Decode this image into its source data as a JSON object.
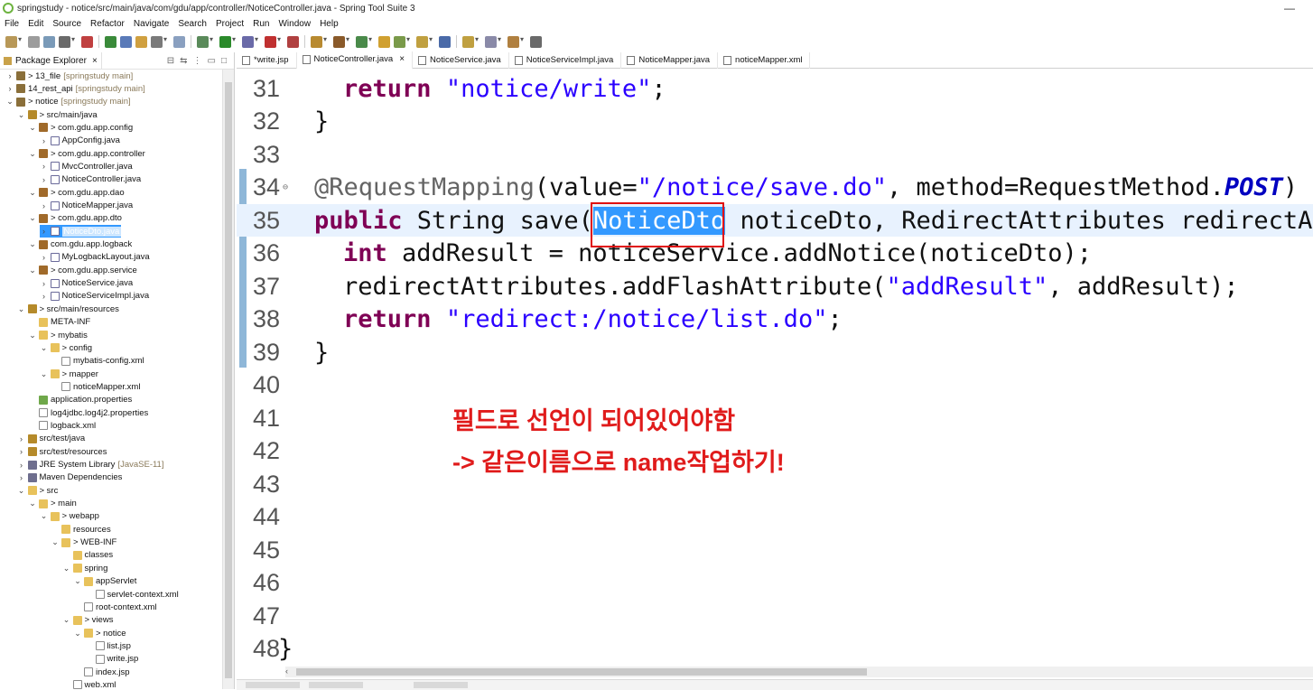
{
  "window": {
    "title": "springstudy - notice/src/main/java/com/gdu/app/controller/NoticeController.java - Spring Tool Suite 3",
    "minimize": "—"
  },
  "menu": [
    "File",
    "Edit",
    "Source",
    "Refactor",
    "Navigate",
    "Search",
    "Project",
    "Run",
    "Window",
    "Help"
  ],
  "explorer": {
    "tab_label": "Package Explorer",
    "close": "×",
    "tree": [
      {
        "label": "> 13_file",
        "suffix": "[springstudy main]",
        "depth": 0,
        "tw": "›",
        "icon": "proj"
      },
      {
        "label": "14_rest_api",
        "suffix": "[springstudy main]",
        "depth": 0,
        "tw": "›",
        "icon": "proj"
      },
      {
        "label": "> notice",
        "suffix": "[springstudy main]",
        "depth": 0,
        "tw": "⌄",
        "icon": "proj"
      },
      {
        "label": "> src/main/java",
        "suffix": "",
        "depth": 1,
        "tw": "⌄",
        "icon": "src"
      },
      {
        "label": "> com.gdu.app.config",
        "suffix": "",
        "depth": 2,
        "tw": "⌄",
        "icon": "pkg"
      },
      {
        "label": "AppConfig.java",
        "suffix": "",
        "depth": 3,
        "tw": "›",
        "icon": "java"
      },
      {
        "label": "> com.gdu.app.controller",
        "suffix": "",
        "depth": 2,
        "tw": "⌄",
        "icon": "pkg"
      },
      {
        "label": "MvcController.java",
        "suffix": "",
        "depth": 3,
        "tw": "›",
        "icon": "java"
      },
      {
        "label": "NoticeController.java",
        "suffix": "",
        "depth": 3,
        "tw": "›",
        "icon": "java"
      },
      {
        "label": "> com.gdu.app.dao",
        "suffix": "",
        "depth": 2,
        "tw": "⌄",
        "icon": "pkg"
      },
      {
        "label": "NoticeMapper.java",
        "suffix": "",
        "depth": 3,
        "tw": "›",
        "icon": "java"
      },
      {
        "label": "> com.gdu.app.dto",
        "suffix": "",
        "depth": 2,
        "tw": "⌄",
        "icon": "pkg"
      },
      {
        "label": "NoticeDto.java",
        "suffix": "",
        "depth": 3,
        "tw": "›",
        "icon": "java",
        "selected": true
      },
      {
        "label": "com.gdu.app.logback",
        "suffix": "",
        "depth": 2,
        "tw": "⌄",
        "icon": "pkg"
      },
      {
        "label": "MyLogbackLayout.java",
        "suffix": "",
        "depth": 3,
        "tw": "›",
        "icon": "java"
      },
      {
        "label": "> com.gdu.app.service",
        "suffix": "",
        "depth": 2,
        "tw": "⌄",
        "icon": "pkg"
      },
      {
        "label": "NoticeService.java",
        "suffix": "",
        "depth": 3,
        "tw": "›",
        "icon": "java"
      },
      {
        "label": "NoticeServiceImpl.java",
        "suffix": "",
        "depth": 3,
        "tw": "›",
        "icon": "java"
      },
      {
        "label": "> src/main/resources",
        "suffix": "",
        "depth": 1,
        "tw": "⌄",
        "icon": "src"
      },
      {
        "label": "META-INF",
        "suffix": "",
        "depth": 2,
        "tw": "",
        "icon": "fold"
      },
      {
        "label": "> mybatis",
        "suffix": "",
        "depth": 2,
        "tw": "⌄",
        "icon": "fold"
      },
      {
        "label": "> config",
        "suffix": "",
        "depth": 3,
        "tw": "⌄",
        "icon": "fold"
      },
      {
        "label": "mybatis-config.xml",
        "suffix": "",
        "depth": 4,
        "tw": "",
        "icon": "xml"
      },
      {
        "label": "> mapper",
        "suffix": "",
        "depth": 3,
        "tw": "⌄",
        "icon": "fold"
      },
      {
        "label": "noticeMapper.xml",
        "suffix": "",
        "depth": 4,
        "tw": "",
        "icon": "xml"
      },
      {
        "label": "application.properties",
        "suffix": "",
        "depth": 2,
        "tw": "",
        "icon": "prop"
      },
      {
        "label": "log4jdbc.log4j2.properties",
        "suffix": "",
        "depth": 2,
        "tw": "",
        "icon": "xml"
      },
      {
        "label": "logback.xml",
        "suffix": "",
        "depth": 2,
        "tw": "",
        "icon": "xml"
      },
      {
        "label": "src/test/java",
        "suffix": "",
        "depth": 1,
        "tw": "›",
        "icon": "src"
      },
      {
        "label": "src/test/resources",
        "suffix": "",
        "depth": 1,
        "tw": "›",
        "icon": "src"
      },
      {
        "label": "JRE System Library",
        "suffix": "[JavaSE-11]",
        "depth": 1,
        "tw": "›",
        "icon": "lib"
      },
      {
        "label": "Maven Dependencies",
        "suffix": "",
        "depth": 1,
        "tw": "›",
        "icon": "lib"
      },
      {
        "label": "> src",
        "suffix": "",
        "depth": 1,
        "tw": "⌄",
        "icon": "fold"
      },
      {
        "label": "> main",
        "suffix": "",
        "depth": 2,
        "tw": "⌄",
        "icon": "fold"
      },
      {
        "label": "> webapp",
        "suffix": "",
        "depth": 3,
        "tw": "⌄",
        "icon": "fold"
      },
      {
        "label": "resources",
        "suffix": "",
        "depth": 4,
        "tw": "",
        "icon": "fold"
      },
      {
        "label": "> WEB-INF",
        "suffix": "",
        "depth": 4,
        "tw": "⌄",
        "icon": "fold"
      },
      {
        "label": "classes",
        "suffix": "",
        "depth": 5,
        "tw": "",
        "icon": "fold"
      },
      {
        "label": "spring",
        "suffix": "",
        "depth": 5,
        "tw": "⌄",
        "icon": "fold"
      },
      {
        "label": "appServlet",
        "suffix": "",
        "depth": 6,
        "tw": "⌄",
        "icon": "fold"
      },
      {
        "label": "servlet-context.xml",
        "suffix": "",
        "depth": 7,
        "tw": "",
        "icon": "xml"
      },
      {
        "label": "root-context.xml",
        "suffix": "",
        "depth": 6,
        "tw": "",
        "icon": "xml"
      },
      {
        "label": "> views",
        "suffix": "",
        "depth": 5,
        "tw": "⌄",
        "icon": "fold"
      },
      {
        "label": "> notice",
        "suffix": "",
        "depth": 6,
        "tw": "⌄",
        "icon": "fold"
      },
      {
        "label": "list.jsp",
        "suffix": "",
        "depth": 7,
        "tw": "",
        "icon": "xml"
      },
      {
        "label": "write.jsp",
        "suffix": "",
        "depth": 7,
        "tw": "",
        "icon": "xml"
      },
      {
        "label": "index.jsp",
        "suffix": "",
        "depth": 6,
        "tw": "",
        "icon": "xml"
      },
      {
        "label": "web.xml",
        "suffix": "",
        "depth": 5,
        "tw": "",
        "icon": "xml"
      }
    ]
  },
  "tabs": [
    {
      "label": "*write.jsp",
      "active": false,
      "close": ""
    },
    {
      "label": "NoticeController.java",
      "active": true,
      "close": "×"
    },
    {
      "label": "NoticeService.java",
      "active": false,
      "close": ""
    },
    {
      "label": "NoticeServiceImpl.java",
      "active": false,
      "close": ""
    },
    {
      "label": "NoticeMapper.java",
      "active": false,
      "close": ""
    },
    {
      "label": "noticeMapper.xml",
      "active": false,
      "close": ""
    }
  ],
  "code": [
    {
      "n": "31",
      "indent": 1,
      "parts": [
        {
          "t": "return",
          "c": "kw"
        },
        {
          "t": " ",
          "c": ""
        },
        {
          "t": "\"notice/write\"",
          "c": "str"
        },
        {
          "t": ";",
          "c": ""
        }
      ]
    },
    {
      "n": "32",
      "indent": 0,
      "parts": [
        {
          "t": "}",
          "c": ""
        }
      ]
    },
    {
      "n": "33",
      "indent": 0,
      "parts": []
    },
    {
      "n": "34",
      "indent": 0,
      "fold": "⊖",
      "parts": [
        {
          "t": "@RequestMapping",
          "c": "ann"
        },
        {
          "t": "(value=",
          "c": ""
        },
        {
          "t": "\"/notice/save.do\"",
          "c": "str"
        },
        {
          "t": ", method=RequestMethod.",
          "c": ""
        },
        {
          "t": "POST",
          "c": "ital"
        },
        {
          "t": ")",
          "c": ""
        }
      ]
    },
    {
      "n": "35",
      "indent": 0,
      "cur": true,
      "parts": [
        {
          "t": "public",
          "c": "kw"
        },
        {
          "t": " String save(",
          "c": ""
        },
        {
          "t": "NoticeDto",
          "c": "sel"
        },
        {
          "t": " noticeDto, RedirectAttributes redirectAtt",
          "c": ""
        }
      ]
    },
    {
      "n": "36",
      "indent": 1,
      "parts": [
        {
          "t": "int",
          "c": "kw"
        },
        {
          "t": " addResult = noticeService.addNotice(noticeDto);",
          "c": ""
        }
      ]
    },
    {
      "n": "37",
      "indent": 1,
      "parts": [
        {
          "t": "redirectAttributes.addFlashAttribute(",
          "c": ""
        },
        {
          "t": "\"addResult\"",
          "c": "str"
        },
        {
          "t": ", addResult);",
          "c": ""
        }
      ]
    },
    {
      "n": "38",
      "indent": 1,
      "parts": [
        {
          "t": "return",
          "c": "kw"
        },
        {
          "t": " ",
          "c": ""
        },
        {
          "t": "\"redirect:/notice/list.do\"",
          "c": "str"
        },
        {
          "t": ";",
          "c": ""
        }
      ]
    },
    {
      "n": "39",
      "indent": 0,
      "parts": [
        {
          "t": "}",
          "c": ""
        }
      ]
    },
    {
      "n": "40",
      "indent": 0,
      "parts": []
    },
    {
      "n": "41",
      "indent": 0,
      "parts": []
    },
    {
      "n": "42",
      "indent": 0,
      "parts": []
    },
    {
      "n": "43",
      "indent": 0,
      "parts": []
    },
    {
      "n": "44",
      "indent": 0,
      "parts": []
    },
    {
      "n": "45",
      "indent": 0,
      "parts": []
    },
    {
      "n": "46",
      "indent": 0,
      "parts": []
    },
    {
      "n": "47",
      "indent": 0,
      "parts": []
    },
    {
      "n": "48",
      "indent": -1,
      "parts": [
        {
          "t": "}",
          "c": ""
        }
      ]
    }
  ],
  "annotation": {
    "line1": "필드로 선언이 되어있어야함",
    "line2": "-> 같은이름으로 name작업하기!",
    "color": "#e01b1b"
  },
  "hscroll_arrow": "‹"
}
